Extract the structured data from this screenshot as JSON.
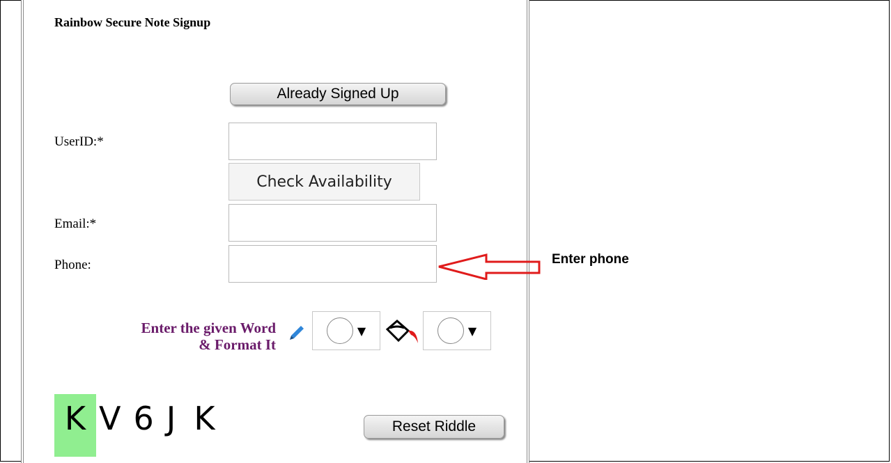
{
  "form": {
    "title": "Rainbow Secure Note Signup",
    "already_signed_up": "Already Signed Up",
    "userid_label": "UserID:*",
    "check_availability": "Check Availability",
    "email_label": "Email:*",
    "phone_label": "Phone:",
    "riddle_label_line1": "Enter the given Word",
    "riddle_label_line2": "& Format It",
    "captcha": [
      "K",
      "V",
      "6",
      "J",
      "K"
    ],
    "reset_riddle": "Reset Riddle"
  },
  "annotation": {
    "text": "Enter phone",
    "arrow_color": "#e01b1b"
  },
  "icons": {
    "pencil": "pencil-icon",
    "bucket": "paint-bucket-icon",
    "caret": "▼"
  },
  "colors": {
    "riddle_label": "#6a1b6a",
    "captcha_highlight": "#90ee90"
  }
}
